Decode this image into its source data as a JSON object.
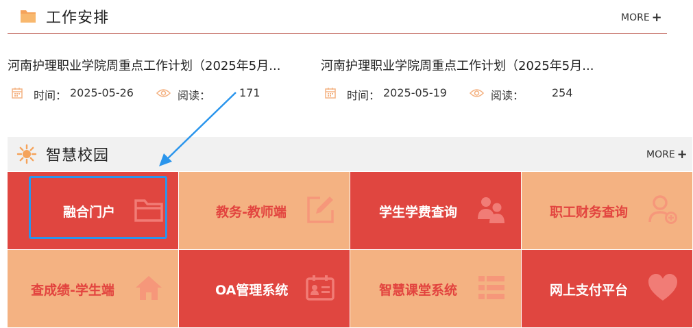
{
  "work": {
    "title": "工作安排",
    "more_label": "MORE",
    "more_plus": "+",
    "items": [
      {
        "title": "河南护理职业学院周重点工作计划（2025年5月...",
        "time_label": "时间：",
        "time": "2025-05-26",
        "read_label": "阅读：",
        "reads": "171"
      },
      {
        "title": "河南护理职业学院周重点工作计划（2025年5月...",
        "time_label": "时间：",
        "time": "2025-05-19",
        "read_label": "阅读：",
        "reads": "254"
      }
    ]
  },
  "campus": {
    "title": "智慧校园",
    "more_label": "MORE",
    "more_plus": "+",
    "tiles": [
      {
        "label": "融合门户",
        "icon": "folder-icon",
        "color": "#e04640"
      },
      {
        "label": "教务-教师端",
        "icon": "edit-icon",
        "color": "#f4b282"
      },
      {
        "label": "学生学费查询",
        "icon": "users-icon",
        "color": "#e04640"
      },
      {
        "label": "职工财务查询",
        "icon": "user-add-icon",
        "color": "#f4b282"
      },
      {
        "label": "查成绩-学生端",
        "icon": "home-icon",
        "color": "#f4b282"
      },
      {
        "label": "OA管理系统",
        "icon": "id-card-icon",
        "color": "#e04640"
      },
      {
        "label": "智慧课堂系统",
        "icon": "list-icon",
        "color": "#f4b282"
      },
      {
        "label": "网上支付平台",
        "icon": "heart-icon",
        "color": "#e04640"
      }
    ]
  },
  "colors": {
    "accent_red": "#e04640",
    "accent_peach": "#f4b282",
    "highlight_blue": "#2a95ec",
    "icon_orange": "#f5a35b"
  }
}
